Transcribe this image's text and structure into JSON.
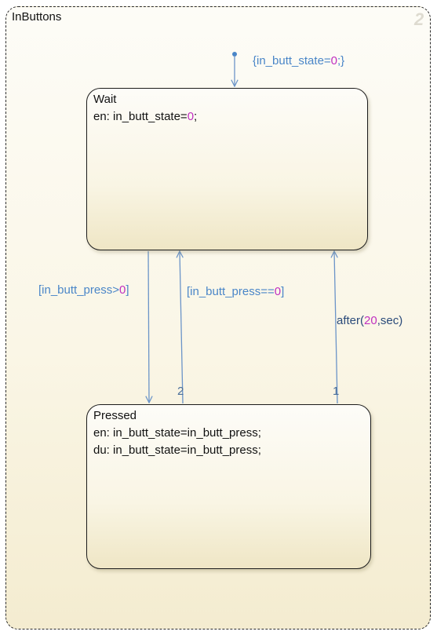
{
  "superstate": {
    "title": "InButtons",
    "number": "2"
  },
  "default_transition": {
    "label_prefix": "{in_butt_state=",
    "label_value": "0",
    "label_suffix": ";}"
  },
  "wait": {
    "name": "Wait",
    "entry_prefix": "en: in_butt_state=",
    "entry_value": "0",
    "entry_suffix": ";"
  },
  "pressed": {
    "name": "Pressed",
    "entry": "en: in_butt_state=in_butt_press;",
    "during": "du: in_butt_state=in_butt_press;"
  },
  "transitions": {
    "wait_to_pressed": {
      "prefix": "[in_butt_press>",
      "value": "0",
      "suffix": "]"
    },
    "pressed_to_wait_release": {
      "prefix": "[in_butt_press==",
      "value": "0",
      "suffix": "]",
      "order": "2"
    },
    "pressed_to_wait_timeout": {
      "prefix": "after(",
      "value": "20",
      "suffix": ",sec)",
      "order": "1"
    }
  },
  "colors": {
    "transition_line": "#6b94c8",
    "label_text": "#4a86c8",
    "numeric_literal": "#c030c0",
    "state_border": "#1c1c1c"
  }
}
